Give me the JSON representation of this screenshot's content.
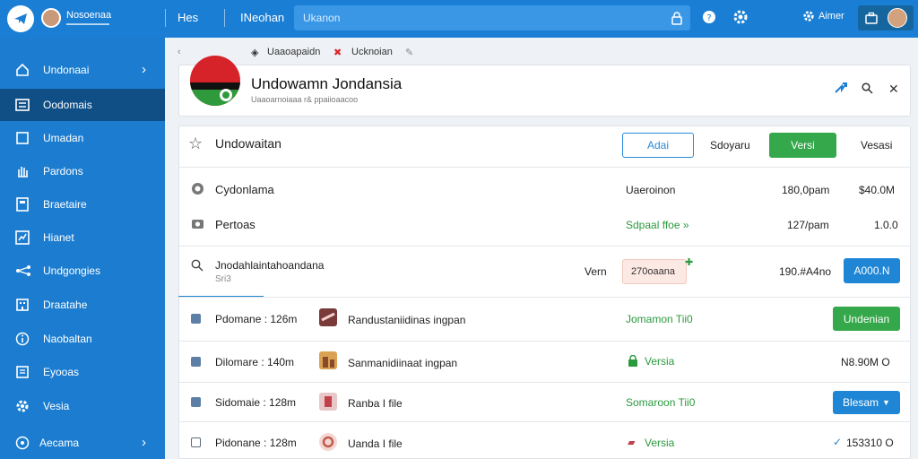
{
  "topbar": {
    "user_name": "Nosoenaa",
    "title1": "Hes",
    "title2": "INeohan",
    "search_placeholder": "Ukanon",
    "admin_label": "Aimer"
  },
  "sidebar": {
    "items": [
      {
        "label": "Undonaai",
        "icon": "home-icon",
        "chevron": "›"
      },
      {
        "label": "Oodomais",
        "icon": "list-icon"
      },
      {
        "label": "Umadan",
        "icon": "square-icon"
      },
      {
        "label": "Pardons",
        "icon": "hand-icon"
      },
      {
        "label": "Braetaire",
        "icon": "calculator-icon"
      },
      {
        "label": "Hianet",
        "icon": "chart-icon"
      },
      {
        "label": "Undgongies",
        "icon": "network-icon"
      },
      {
        "label": "Draatahe",
        "icon": "building-icon"
      },
      {
        "label": "Naobaltan",
        "icon": "info-icon"
      },
      {
        "label": "Eyooas",
        "icon": "document-icon"
      },
      {
        "label": "Vesia",
        "icon": "gear-icon"
      },
      {
        "label": "Aecama",
        "icon": "help-icon",
        "chevron": "›"
      }
    ]
  },
  "breadcrumbs": {
    "item1": "Uaaoapaidn",
    "item2": "Ucknoian"
  },
  "header": {
    "title": "Undowamn Jondansia",
    "subtitle": "Uaaoarnoiaaa r& ppaiioaacoo"
  },
  "toolbar": {
    "title": "Undowaitan",
    "add_label": "Adai",
    "select_label": "Sdoyaru",
    "green_label": "Versi",
    "extra_label": "Vesasi"
  },
  "summary": {
    "rows": [
      {
        "name": "Cydonlama",
        "label": "Uaeroinon",
        "time": "180,0pam",
        "amount": "$40.0M"
      },
      {
        "name": "Pertoas",
        "label": "Sdpaal ffoe »",
        "time": "127/pam",
        "amount": "1.0.0"
      }
    ]
  },
  "search_row": {
    "title": "Jnodahlaintahoandana",
    "sub": "Sri3",
    "ver": "Vern",
    "badge": "270oaana",
    "time": "190.#A4no",
    "button": "A000.N"
  },
  "file_rows": [
    {
      "name": "Pdomane : 126m",
      "file": "Randustaniidinas ingpan",
      "status": "Jomamon Tii0",
      "action": "Undenian",
      "action_type": "green-button"
    },
    {
      "name": "Dilomare : 140m",
      "file": "Sanmanidiinaat ingpan",
      "status": "Versia",
      "action": "N8.90M O",
      "action_type": "text"
    },
    {
      "name": "Sidomaie : 128m",
      "file": "Ranba I file",
      "status": "Somaroon Tii0",
      "action": "Blesam",
      "action_type": "blue-dropdown"
    },
    {
      "name": "Pidonane : 128m",
      "file": "Uanda I file",
      "status": "Versia",
      "action": "153310 O",
      "action_type": "text"
    }
  ],
  "colors": {
    "primary": "#1a7fd4",
    "sidebar": "#1c7dd0",
    "sidebar_active": "#0f4f86",
    "green": "#34a84a",
    "accent_text_green": "#2b9a3e"
  }
}
